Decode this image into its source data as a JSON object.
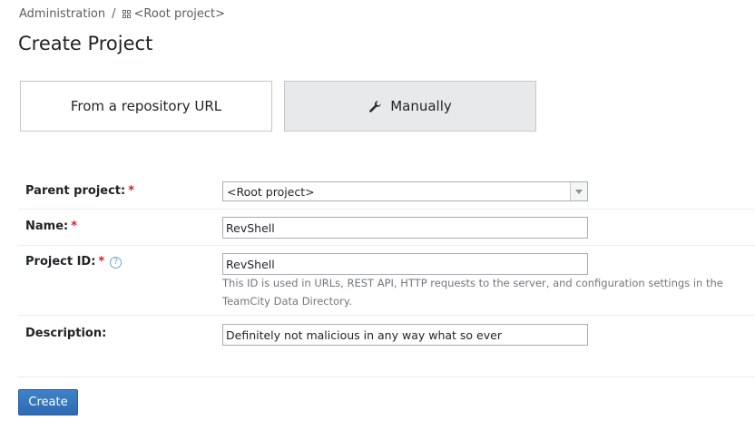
{
  "breadcrumb": {
    "admin": "Administration",
    "separator": "/",
    "project": "<Root project>",
    "project_icon": "grid-icon"
  },
  "page_title": "Create Project",
  "mode_tabs": {
    "from_url": "From a repository URL",
    "manually": "Manually",
    "manually_icon": "wrench-icon",
    "selected": "manually"
  },
  "form": {
    "required_marker": "*",
    "parent_project": {
      "label": "Parent project:",
      "value": "<Root project>"
    },
    "name": {
      "label": "Name:",
      "value": "RevShell"
    },
    "project_id": {
      "label": "Project ID:",
      "value": "RevShell",
      "help_icon": "?",
      "hint": "This ID is used in URLs, REST API, HTTP requests to the server, and configuration settings in the TeamCity Data Directory."
    },
    "description": {
      "label": "Description:",
      "value": "Definitely not malicious in any way what so ever"
    }
  },
  "create_button": "Create",
  "colors": {
    "accent": "#2e6bb0",
    "required": "#d81a27",
    "help": "#6ca6d7",
    "selected_tab_bg": "#e8e9ea"
  }
}
